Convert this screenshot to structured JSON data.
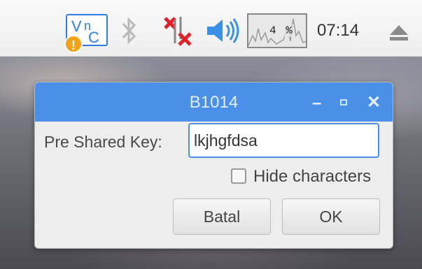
{
  "taskbar": {
    "cpu_usage": "4 %",
    "clock": "07:14",
    "icons": [
      "vnc-icon",
      "warning-icon",
      "bluetooth-icon",
      "network-disconnected-icon",
      "volume-icon",
      "cpu-monitor",
      "eject-icon"
    ]
  },
  "dialog": {
    "title": "B1014",
    "psk_label": "Pre Shared Key:",
    "psk_value": "lkjhgfdsa",
    "hide_label": "Hide characters",
    "hide_checked": false,
    "cancel_label": "Batal",
    "ok_label": "OK"
  },
  "colors": {
    "accent": "#4a90e8",
    "warning": "#f2a21a",
    "network_error": "#e0202a",
    "volume": "#3a8fe6"
  }
}
